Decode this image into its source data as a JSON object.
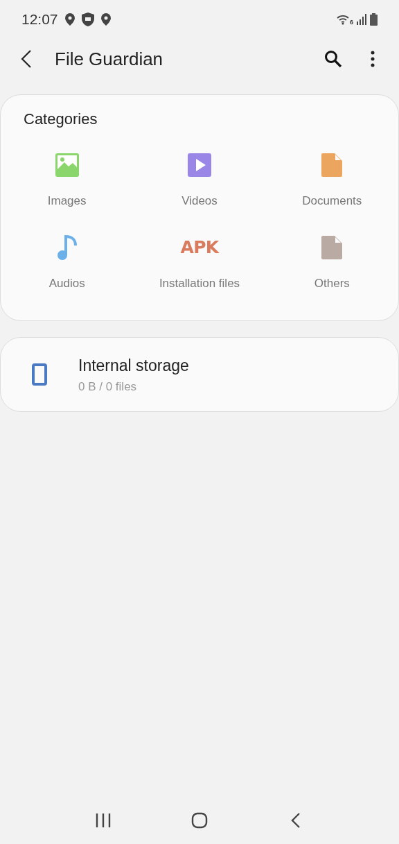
{
  "status_bar": {
    "time": "12:07",
    "wifi_badge": "6"
  },
  "header": {
    "title": "File Guardian"
  },
  "categories": {
    "title": "Categories",
    "items": [
      {
        "kind": "image",
        "label": "Images"
      },
      {
        "kind": "video",
        "label": "Videos"
      },
      {
        "kind": "document",
        "label": "Documents"
      },
      {
        "kind": "audio",
        "label": "Audios"
      },
      {
        "kind": "apk",
        "label": "Installation files",
        "icon_text": "APK"
      },
      {
        "kind": "other",
        "label": "Others"
      }
    ]
  },
  "storage": {
    "name": "Internal storage",
    "detail": "0 B / 0 files"
  }
}
